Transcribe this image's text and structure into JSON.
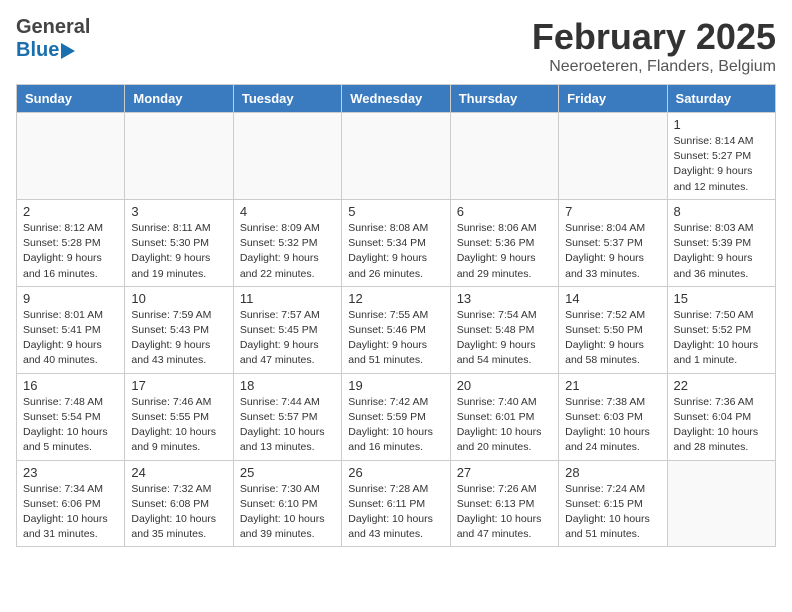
{
  "header": {
    "logo_general": "General",
    "logo_blue": "Blue",
    "month_title": "February 2025",
    "location": "Neeroeteren, Flanders, Belgium"
  },
  "weekdays": [
    "Sunday",
    "Monday",
    "Tuesday",
    "Wednesday",
    "Thursday",
    "Friday",
    "Saturday"
  ],
  "weeks": [
    [
      {
        "day": "",
        "info": ""
      },
      {
        "day": "",
        "info": ""
      },
      {
        "day": "",
        "info": ""
      },
      {
        "day": "",
        "info": ""
      },
      {
        "day": "",
        "info": ""
      },
      {
        "day": "",
        "info": ""
      },
      {
        "day": "1",
        "info": "Sunrise: 8:14 AM\nSunset: 5:27 PM\nDaylight: 9 hours and 12 minutes."
      }
    ],
    [
      {
        "day": "2",
        "info": "Sunrise: 8:12 AM\nSunset: 5:28 PM\nDaylight: 9 hours and 16 minutes."
      },
      {
        "day": "3",
        "info": "Sunrise: 8:11 AM\nSunset: 5:30 PM\nDaylight: 9 hours and 19 minutes."
      },
      {
        "day": "4",
        "info": "Sunrise: 8:09 AM\nSunset: 5:32 PM\nDaylight: 9 hours and 22 minutes."
      },
      {
        "day": "5",
        "info": "Sunrise: 8:08 AM\nSunset: 5:34 PM\nDaylight: 9 hours and 26 minutes."
      },
      {
        "day": "6",
        "info": "Sunrise: 8:06 AM\nSunset: 5:36 PM\nDaylight: 9 hours and 29 minutes."
      },
      {
        "day": "7",
        "info": "Sunrise: 8:04 AM\nSunset: 5:37 PM\nDaylight: 9 hours and 33 minutes."
      },
      {
        "day": "8",
        "info": "Sunrise: 8:03 AM\nSunset: 5:39 PM\nDaylight: 9 hours and 36 minutes."
      }
    ],
    [
      {
        "day": "9",
        "info": "Sunrise: 8:01 AM\nSunset: 5:41 PM\nDaylight: 9 hours and 40 minutes."
      },
      {
        "day": "10",
        "info": "Sunrise: 7:59 AM\nSunset: 5:43 PM\nDaylight: 9 hours and 43 minutes."
      },
      {
        "day": "11",
        "info": "Sunrise: 7:57 AM\nSunset: 5:45 PM\nDaylight: 9 hours and 47 minutes."
      },
      {
        "day": "12",
        "info": "Sunrise: 7:55 AM\nSunset: 5:46 PM\nDaylight: 9 hours and 51 minutes."
      },
      {
        "day": "13",
        "info": "Sunrise: 7:54 AM\nSunset: 5:48 PM\nDaylight: 9 hours and 54 minutes."
      },
      {
        "day": "14",
        "info": "Sunrise: 7:52 AM\nSunset: 5:50 PM\nDaylight: 9 hours and 58 minutes."
      },
      {
        "day": "15",
        "info": "Sunrise: 7:50 AM\nSunset: 5:52 PM\nDaylight: 10 hours and 1 minute."
      }
    ],
    [
      {
        "day": "16",
        "info": "Sunrise: 7:48 AM\nSunset: 5:54 PM\nDaylight: 10 hours and 5 minutes."
      },
      {
        "day": "17",
        "info": "Sunrise: 7:46 AM\nSunset: 5:55 PM\nDaylight: 10 hours and 9 minutes."
      },
      {
        "day": "18",
        "info": "Sunrise: 7:44 AM\nSunset: 5:57 PM\nDaylight: 10 hours and 13 minutes."
      },
      {
        "day": "19",
        "info": "Sunrise: 7:42 AM\nSunset: 5:59 PM\nDaylight: 10 hours and 16 minutes."
      },
      {
        "day": "20",
        "info": "Sunrise: 7:40 AM\nSunset: 6:01 PM\nDaylight: 10 hours and 20 minutes."
      },
      {
        "day": "21",
        "info": "Sunrise: 7:38 AM\nSunset: 6:03 PM\nDaylight: 10 hours and 24 minutes."
      },
      {
        "day": "22",
        "info": "Sunrise: 7:36 AM\nSunset: 6:04 PM\nDaylight: 10 hours and 28 minutes."
      }
    ],
    [
      {
        "day": "23",
        "info": "Sunrise: 7:34 AM\nSunset: 6:06 PM\nDaylight: 10 hours and 31 minutes."
      },
      {
        "day": "24",
        "info": "Sunrise: 7:32 AM\nSunset: 6:08 PM\nDaylight: 10 hours and 35 minutes."
      },
      {
        "day": "25",
        "info": "Sunrise: 7:30 AM\nSunset: 6:10 PM\nDaylight: 10 hours and 39 minutes."
      },
      {
        "day": "26",
        "info": "Sunrise: 7:28 AM\nSunset: 6:11 PM\nDaylight: 10 hours and 43 minutes."
      },
      {
        "day": "27",
        "info": "Sunrise: 7:26 AM\nSunset: 6:13 PM\nDaylight: 10 hours and 47 minutes."
      },
      {
        "day": "28",
        "info": "Sunrise: 7:24 AM\nSunset: 6:15 PM\nDaylight: 10 hours and 51 minutes."
      },
      {
        "day": "",
        "info": ""
      }
    ]
  ]
}
